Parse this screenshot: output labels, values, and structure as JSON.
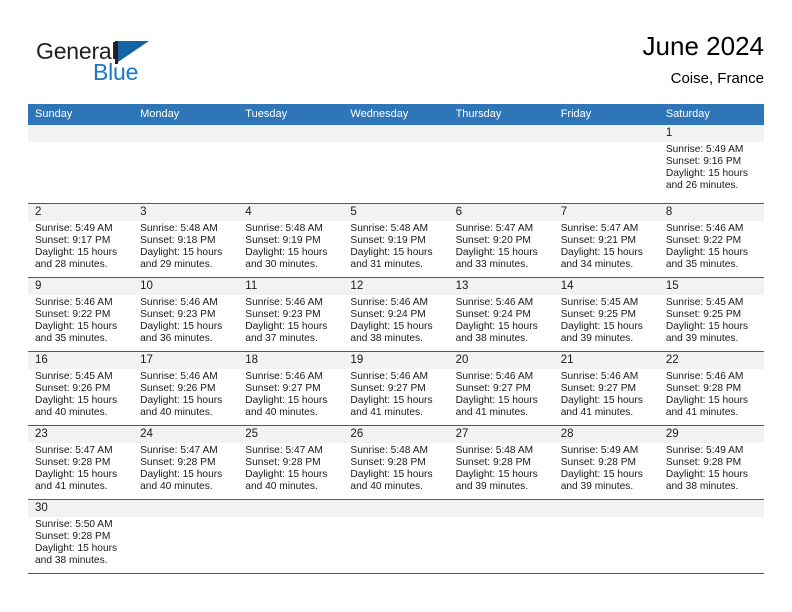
{
  "brand": {
    "name_part1": "General",
    "name_part2": "Blue",
    "flag_icon": "triangle-flag-icon",
    "accent_color": "#1464a5"
  },
  "header": {
    "title": "June 2024",
    "subtitle": "Coise, France"
  },
  "theme": {
    "header_blue": "#2f76b8",
    "row_divider": "#2f5f95",
    "daynum_band": "#f2f2f2"
  },
  "weekdays": [
    "Sunday",
    "Monday",
    "Tuesday",
    "Wednesday",
    "Thursday",
    "Friday",
    "Saturday"
  ],
  "weeks": [
    {
      "days": [
        {
          "num": "",
          "empty": true
        },
        {
          "num": "",
          "empty": true
        },
        {
          "num": "",
          "empty": true
        },
        {
          "num": "",
          "empty": true
        },
        {
          "num": "",
          "empty": true
        },
        {
          "num": "",
          "empty": true
        },
        {
          "num": "1",
          "sunrise": "Sunrise: 5:49 AM",
          "sunset": "Sunset: 9:16 PM",
          "daylight1": "Daylight: 15 hours",
          "daylight2": "and 26 minutes."
        }
      ]
    },
    {
      "days": [
        {
          "num": "2",
          "sunrise": "Sunrise: 5:49 AM",
          "sunset": "Sunset: 9:17 PM",
          "daylight1": "Daylight: 15 hours",
          "daylight2": "and 28 minutes."
        },
        {
          "num": "3",
          "sunrise": "Sunrise: 5:48 AM",
          "sunset": "Sunset: 9:18 PM",
          "daylight1": "Daylight: 15 hours",
          "daylight2": "and 29 minutes."
        },
        {
          "num": "4",
          "sunrise": "Sunrise: 5:48 AM",
          "sunset": "Sunset: 9:19 PM",
          "daylight1": "Daylight: 15 hours",
          "daylight2": "and 30 minutes."
        },
        {
          "num": "5",
          "sunrise": "Sunrise: 5:48 AM",
          "sunset": "Sunset: 9:19 PM",
          "daylight1": "Daylight: 15 hours",
          "daylight2": "and 31 minutes."
        },
        {
          "num": "6",
          "sunrise": "Sunrise: 5:47 AM",
          "sunset": "Sunset: 9:20 PM",
          "daylight1": "Daylight: 15 hours",
          "daylight2": "and 33 minutes."
        },
        {
          "num": "7",
          "sunrise": "Sunrise: 5:47 AM",
          "sunset": "Sunset: 9:21 PM",
          "daylight1": "Daylight: 15 hours",
          "daylight2": "and 34 minutes."
        },
        {
          "num": "8",
          "sunrise": "Sunrise: 5:46 AM",
          "sunset": "Sunset: 9:22 PM",
          "daylight1": "Daylight: 15 hours",
          "daylight2": "and 35 minutes."
        }
      ]
    },
    {
      "days": [
        {
          "num": "9",
          "sunrise": "Sunrise: 5:46 AM",
          "sunset": "Sunset: 9:22 PM",
          "daylight1": "Daylight: 15 hours",
          "daylight2": "and 35 minutes."
        },
        {
          "num": "10",
          "sunrise": "Sunrise: 5:46 AM",
          "sunset": "Sunset: 9:23 PM",
          "daylight1": "Daylight: 15 hours",
          "daylight2": "and 36 minutes."
        },
        {
          "num": "11",
          "sunrise": "Sunrise: 5:46 AM",
          "sunset": "Sunset: 9:23 PM",
          "daylight1": "Daylight: 15 hours",
          "daylight2": "and 37 minutes."
        },
        {
          "num": "12",
          "sunrise": "Sunrise: 5:46 AM",
          "sunset": "Sunset: 9:24 PM",
          "daylight1": "Daylight: 15 hours",
          "daylight2": "and 38 minutes."
        },
        {
          "num": "13",
          "sunrise": "Sunrise: 5:46 AM",
          "sunset": "Sunset: 9:24 PM",
          "daylight1": "Daylight: 15 hours",
          "daylight2": "and 38 minutes."
        },
        {
          "num": "14",
          "sunrise": "Sunrise: 5:45 AM",
          "sunset": "Sunset: 9:25 PM",
          "daylight1": "Daylight: 15 hours",
          "daylight2": "and 39 minutes."
        },
        {
          "num": "15",
          "sunrise": "Sunrise: 5:45 AM",
          "sunset": "Sunset: 9:25 PM",
          "daylight1": "Daylight: 15 hours",
          "daylight2": "and 39 minutes."
        }
      ]
    },
    {
      "days": [
        {
          "num": "16",
          "sunrise": "Sunrise: 5:45 AM",
          "sunset": "Sunset: 9:26 PM",
          "daylight1": "Daylight: 15 hours",
          "daylight2": "and 40 minutes."
        },
        {
          "num": "17",
          "sunrise": "Sunrise: 5:46 AM",
          "sunset": "Sunset: 9:26 PM",
          "daylight1": "Daylight: 15 hours",
          "daylight2": "and 40 minutes."
        },
        {
          "num": "18",
          "sunrise": "Sunrise: 5:46 AM",
          "sunset": "Sunset: 9:27 PM",
          "daylight1": "Daylight: 15 hours",
          "daylight2": "and 40 minutes."
        },
        {
          "num": "19",
          "sunrise": "Sunrise: 5:46 AM",
          "sunset": "Sunset: 9:27 PM",
          "daylight1": "Daylight: 15 hours",
          "daylight2": "and 41 minutes."
        },
        {
          "num": "20",
          "sunrise": "Sunrise: 5:46 AM",
          "sunset": "Sunset: 9:27 PM",
          "daylight1": "Daylight: 15 hours",
          "daylight2": "and 41 minutes."
        },
        {
          "num": "21",
          "sunrise": "Sunrise: 5:46 AM",
          "sunset": "Sunset: 9:27 PM",
          "daylight1": "Daylight: 15 hours",
          "daylight2": "and 41 minutes."
        },
        {
          "num": "22",
          "sunrise": "Sunrise: 5:46 AM",
          "sunset": "Sunset: 9:28 PM",
          "daylight1": "Daylight: 15 hours",
          "daylight2": "and 41 minutes."
        }
      ]
    },
    {
      "days": [
        {
          "num": "23",
          "sunrise": "Sunrise: 5:47 AM",
          "sunset": "Sunset: 9:28 PM",
          "daylight1": "Daylight: 15 hours",
          "daylight2": "and 41 minutes."
        },
        {
          "num": "24",
          "sunrise": "Sunrise: 5:47 AM",
          "sunset": "Sunset: 9:28 PM",
          "daylight1": "Daylight: 15 hours",
          "daylight2": "and 40 minutes."
        },
        {
          "num": "25",
          "sunrise": "Sunrise: 5:47 AM",
          "sunset": "Sunset: 9:28 PM",
          "daylight1": "Daylight: 15 hours",
          "daylight2": "and 40 minutes."
        },
        {
          "num": "26",
          "sunrise": "Sunrise: 5:48 AM",
          "sunset": "Sunset: 9:28 PM",
          "daylight1": "Daylight: 15 hours",
          "daylight2": "and 40 minutes."
        },
        {
          "num": "27",
          "sunrise": "Sunrise: 5:48 AM",
          "sunset": "Sunset: 9:28 PM",
          "daylight1": "Daylight: 15 hours",
          "daylight2": "and 39 minutes."
        },
        {
          "num": "28",
          "sunrise": "Sunrise: 5:49 AM",
          "sunset": "Sunset: 9:28 PM",
          "daylight1": "Daylight: 15 hours",
          "daylight2": "and 39 minutes."
        },
        {
          "num": "29",
          "sunrise": "Sunrise: 5:49 AM",
          "sunset": "Sunset: 9:28 PM",
          "daylight1": "Daylight: 15 hours",
          "daylight2": "and 38 minutes."
        }
      ]
    },
    {
      "days": [
        {
          "num": "30",
          "sunrise": "Sunrise: 5:50 AM",
          "sunset": "Sunset: 9:28 PM",
          "daylight1": "Daylight: 15 hours",
          "daylight2": "and 38 minutes."
        },
        {
          "num": "",
          "empty": true
        },
        {
          "num": "",
          "empty": true
        },
        {
          "num": "",
          "empty": true
        },
        {
          "num": "",
          "empty": true
        },
        {
          "num": "",
          "empty": true
        },
        {
          "num": "",
          "empty": true
        }
      ]
    }
  ]
}
